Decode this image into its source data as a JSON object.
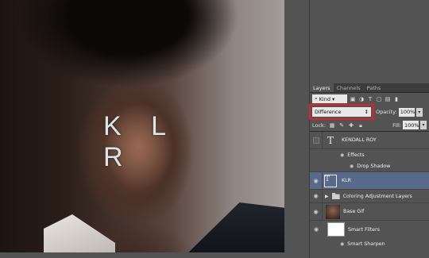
{
  "canvas": {
    "overlay_text": "K L R"
  },
  "panel": {
    "tabs": [
      "Layers",
      "Channels",
      "Paths"
    ],
    "filter": {
      "kind_label": "Kind",
      "search_icon": "magnify-icon"
    },
    "blend_mode": "Difference",
    "opacity_label": "Opacity:",
    "opacity_value": "100%",
    "lock_label": "Lock:",
    "fill_label": "Fill:",
    "fill_value": "100%",
    "layers": {
      "kendall": "KENDALL ROY",
      "effects": "Effects",
      "drop_shadow": "Drop Shadow",
      "klr": "KLR",
      "coloring_group": "Coloring Adjustment Layers",
      "base_gif": "Base Gif",
      "smart_filters": "Smart Filters",
      "smart_sharpen": "Smart Sharpen"
    }
  },
  "colors": {
    "highlight": "#e0202a",
    "selected_row": "#58698a"
  }
}
